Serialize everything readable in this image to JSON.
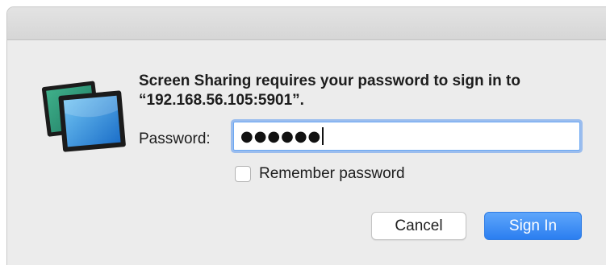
{
  "dialog": {
    "message": "Screen Sharing requires your password to sign in to “192.168.56.105:5901”.",
    "password_label": "Password:",
    "password_value": "●●●●●●",
    "remember_label": "Remember password",
    "remember_checked": false,
    "cancel_label": "Cancel",
    "signin_label": "Sign In",
    "app_icon": "screen-sharing-icon"
  },
  "colors": {
    "accent": "#2b7ef0",
    "window_bg": "#ececec",
    "focus_ring": "#6aa7f3"
  }
}
